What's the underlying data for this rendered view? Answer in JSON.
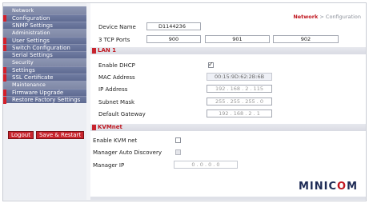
{
  "sidebar": {
    "sections": [
      {
        "title": "Network",
        "items": [
          "Configuration",
          "SNMP Settings"
        ]
      },
      {
        "title": "Administration",
        "items": [
          "User Settings",
          "Switch Configuration",
          "Serial Settings"
        ]
      },
      {
        "title": "Security",
        "items": [
          "Settings",
          "SSL Certificate"
        ]
      },
      {
        "title": "Maintenance",
        "items": [
          "Firmware Upgrade",
          "Restore Factory Settings"
        ]
      }
    ],
    "logout_label": "Logout",
    "save_restart_label": "Save & Restart"
  },
  "breadcrumb": {
    "section": "Network",
    "separator": ">",
    "page": "Configuration"
  },
  "device": {
    "name_label": "Device Name",
    "name_value": "D1144236",
    "ports_label": "3 TCP Ports",
    "ports": [
      "900",
      "901",
      "902"
    ]
  },
  "lan": {
    "title": "LAN 1",
    "dhcp_label": "Enable DHCP",
    "mac_label": "MAC Address",
    "mac_value": "00:15:9D:62:2B:6B",
    "ip_label": "IP Address",
    "ip_value": "192 . 168 . 2 . 115",
    "mask_label": "Subnet Mask",
    "mask_value": "255 . 255 . 255 . 0",
    "gateway_label": "Default Gateway",
    "gateway_value": "192 . 168 . 2 . 1"
  },
  "kvm": {
    "title": "KVMnet",
    "enable_label": "Enable KVM net",
    "manager_discovery_label": "Manager Auto Discovery",
    "manager_ip_label": "Manager IP",
    "manager_ip_value": "0 . 0 . 0 . 0"
  },
  "brand": {
    "logo_before": "MINIC",
    "logo_o": "O",
    "logo_after": "M"
  },
  "colors": {
    "accent": "#c8242d",
    "nav": "#6f7ba1",
    "brand_dark": "#1e2b55"
  }
}
